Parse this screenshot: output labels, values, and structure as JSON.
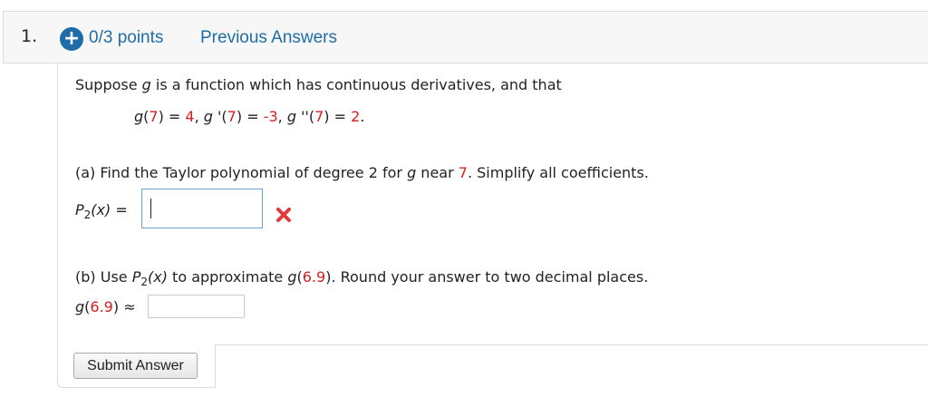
{
  "header": {
    "question_number": "1.",
    "expand_icon": "plus-circle-icon",
    "expand_symbol": "+",
    "points": "0/3 points",
    "previous_answers": "Previous Answers"
  },
  "problem": {
    "intro_prefix": "Suppose ",
    "intro_var": "g",
    "intro_suffix": " is a function which has continuous derivatives, and that",
    "conditions": {
      "f1": "g",
      "p1a": "(",
      "v7a": "7",
      "p1b": ") = ",
      "v4": "4",
      "sep1": ", ",
      "f2": "g",
      "p2a": " '(",
      "v7b": "7",
      "p2b": ") = ",
      "vm3": "-3",
      "sep2": ", ",
      "f3": "g",
      "p3a": " ''(",
      "v7c": "7",
      "p3b": ") = ",
      "v2": "2",
      "end": "."
    }
  },
  "part_a": {
    "prefix": "(a) Find the Taylor polynomial of degree 2 for ",
    "var": "g",
    "mid": " near ",
    "point": "7",
    "suffix": ". Simplify all coefficients.",
    "label_p": "P",
    "label_sub": "2",
    "label_x": "(x)",
    "label_eq": " = ",
    "answer_value": "",
    "status_icon": "incorrect-x-icon"
  },
  "part_b": {
    "prefix": "(b) Use ",
    "p": "P",
    "sub": "2",
    "x": "(x)",
    "mid": " to approximate ",
    "var": "g",
    "open": "(",
    "val": "6.9",
    "suffix": "). Round your answer to two decimal places.",
    "label_g": "g",
    "label_open": "(",
    "label_val": "6.9",
    "label_close": ") ≈",
    "answer_value": ""
  },
  "submit": {
    "label": "Submit Answer"
  },
  "colors": {
    "accent": "#1f6da8",
    "given_values": "#d42020",
    "incorrect": "#e03a3a"
  }
}
